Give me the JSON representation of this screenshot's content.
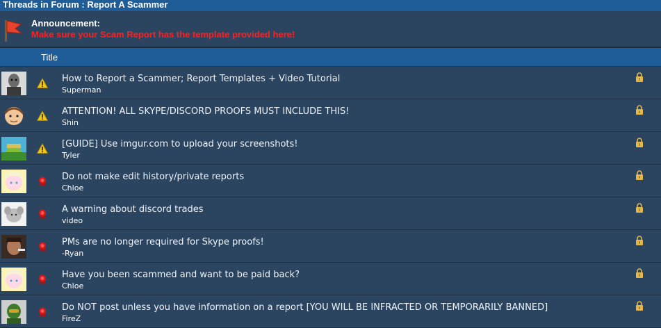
{
  "header": {
    "title": "Threads in Forum : Report A Scammer"
  },
  "announcement": {
    "label": "Announcement:",
    "message": "Make sure your Scam Report has the template provided here!",
    "icon": "flag-icon"
  },
  "columns": {
    "title": "Title"
  },
  "threads": [
    {
      "title": "How to Report a Scammer; Report Templates + Video Tutorial",
      "author": "Superman",
      "status_icon": "warning-icon",
      "locked": true
    },
    {
      "title": "ATTENTION! ALL SKYPE/DISCORD PROOFS MUST INCLUDE THIS!",
      "author": "Shin",
      "status_icon": "warning-icon",
      "locked": true
    },
    {
      "title": "[GUIDE] Use imgur.com to upload your screenshots!",
      "author": "Tyler",
      "status_icon": "warning-icon",
      "locked": true
    },
    {
      "title": "Do not make edit history/private reports",
      "author": "Chloe",
      "status_icon": "ribbon-icon",
      "locked": true
    },
    {
      "title": "A warning about discord trades",
      "author": "video",
      "status_icon": "ribbon-icon",
      "locked": true
    },
    {
      "title": "PMs are no longer required for Skype proofs!",
      "author": "-Ryan",
      "status_icon": "ribbon-icon",
      "locked": true
    },
    {
      "title": "Have you been scammed and want to be paid back?",
      "author": "Chloe",
      "status_icon": "ribbon-icon",
      "locked": true
    },
    {
      "title": "Do NOT post unless you have information on a report [YOU WILL BE INFRACTED OR TEMPORARILY BANNED]",
      "author": "FireZ",
      "status_icon": "ribbon-icon",
      "locked": true
    }
  ],
  "colors": {
    "header_bg": "#1f5d99",
    "row_bg": "#2b4561",
    "announcement_text": "#ff1f1f",
    "warning": "#f2c418",
    "ribbon": "#e01515",
    "lock": "#e3b84a"
  }
}
